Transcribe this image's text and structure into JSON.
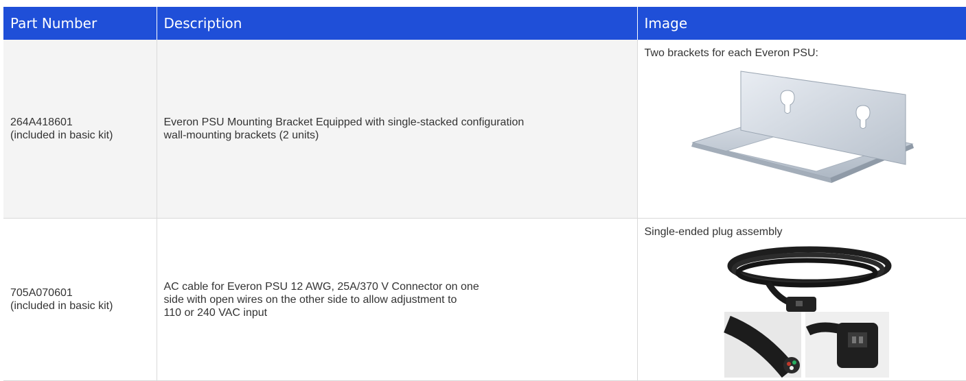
{
  "table": {
    "headers": [
      "Part Number",
      "Description",
      "Image"
    ],
    "rows": [
      {
        "part_number": "264A418601",
        "part_note": "(included in basic kit)",
        "description_lines": [
          "Everon PSU Mounting Bracket Equipped with single-stacked configuration",
          "wall-mounting brackets (2 units)"
        ],
        "image_caption": "Two brackets for each Everon PSU:",
        "image_icon": "mounting-bracket-icon"
      },
      {
        "part_number": "705A070601",
        "part_note": "(included in basic kit)",
        "description_lines": [
          "AC cable for Everon PSU 12 AWG, 25A/370 V Connector on one",
          "side with open wires on the other side to allow adjustment to",
          "110 or 240 VAC input"
        ],
        "image_caption": "Single-ended plug assembly",
        "image_icon": "ac-cable-icon"
      }
    ]
  },
  "colors": {
    "header_bg": "#1f4fd8",
    "header_text": "#ffffff",
    "row_alt_bg": "#f4f4f4",
    "body_text": "#333333"
  }
}
